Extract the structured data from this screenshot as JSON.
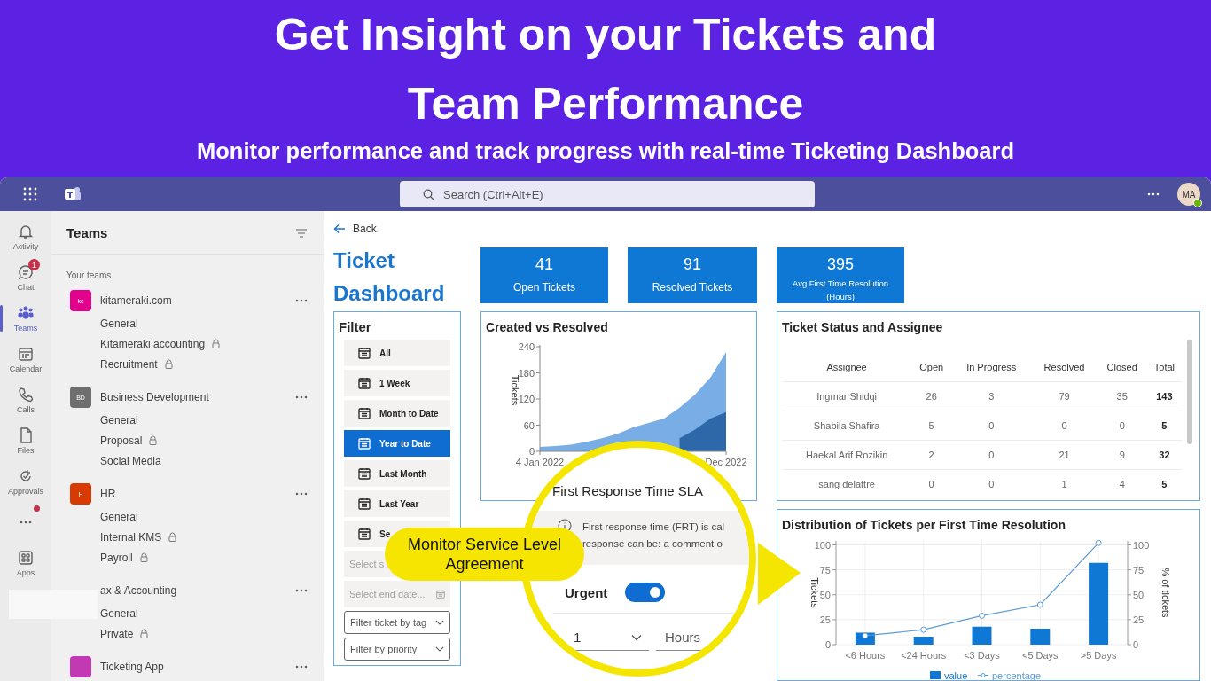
{
  "banner": {
    "headline_lines": [
      "Get Insight on your Tickets and",
      "Team Performance"
    ],
    "subtitle": "Monitor performance and track progress with real-time Ticketing Dashboard"
  },
  "top_bar": {
    "search": {
      "placeholder": "Search (Ctrl+Alt+E)"
    },
    "avatar": "MA"
  },
  "rail": [
    {
      "kind": "app",
      "label": "Activity",
      "selected": false,
      "notification": false
    },
    {
      "kind": "app",
      "label": "Chat",
      "selected": false,
      "badge": "1",
      "notification": false
    },
    {
      "kind": "app",
      "label": "Teams",
      "selected": true,
      "notification": false
    },
    {
      "kind": "app",
      "label": "Calendar",
      "selected": false,
      "notification": false
    },
    {
      "kind": "app",
      "label": "Calls",
      "selected": false,
      "notification": false
    },
    {
      "kind": "app",
      "label": "Files",
      "selected": false,
      "notification": false
    },
    {
      "kind": "app",
      "label": "Approvals",
      "selected": false,
      "notification": false
    },
    {
      "kind": "more",
      "selected": false,
      "notification": true
    },
    {
      "kind": "app",
      "label": "Apps",
      "selected": false,
      "notification": false
    }
  ],
  "teams_panel": {
    "title": "Teams",
    "section": "Your teams",
    "teams": [
      {
        "name": "kitameraki.com",
        "initials": "kc",
        "color": "#e3008c",
        "channels": [
          {
            "name": "General",
            "private": false
          },
          {
            "name": "Kitameraki accounting",
            "private": true
          },
          {
            "name": "Recruitment",
            "private": true
          }
        ]
      },
      {
        "name": "Business Development",
        "initials": "BD",
        "color": "#6e6e6e",
        "channels": [
          {
            "name": "General",
            "private": false
          },
          {
            "name": "Proposal",
            "private": true
          },
          {
            "name": "Social Media",
            "private": false
          }
        ]
      },
      {
        "name": "HR",
        "initials": "H",
        "color": "#d83b01",
        "channels": [
          {
            "name": "General",
            "private": false
          },
          {
            "name": "Internal KMS",
            "private": true
          },
          {
            "name": "Payroll",
            "private": true
          }
        ]
      },
      {
        "name": "ax & Accounting",
        "channels": [
          {
            "name": "General",
            "private": false
          },
          {
            "name": "Private",
            "private": true
          }
        ]
      },
      {
        "name": "Ticketing App",
        "color": "#c239b3"
      }
    ]
  },
  "back": "Back",
  "title": "Ticket Dashboard",
  "kpis": [
    {
      "value": "41",
      "label": "Open Tickets",
      "compact": false
    },
    {
      "value": "91",
      "label": "Resolved Tickets",
      "compact": false
    },
    {
      "value": "395",
      "label": "Avg First Time Resolution (Hours)",
      "compact": true
    }
  ],
  "filter": {
    "title": "Filter",
    "presets": [
      {
        "label": "All",
        "selected": false
      },
      {
        "label": "1 Week",
        "selected": false
      },
      {
        "label": "Month to Date",
        "selected": false
      },
      {
        "label": "Year to Date",
        "selected": true
      },
      {
        "label": "Last Month",
        "selected": false
      },
      {
        "label": "Last Year",
        "selected": false
      },
      {
        "label": "Se",
        "selected": false
      }
    ],
    "date_fields": [
      {
        "placeholder": "Select s"
      },
      {
        "placeholder": "Select end date..."
      }
    ],
    "dropdowns": [
      {
        "placeholder": "Filter ticket by tag"
      },
      {
        "placeholder": "Filter by priority"
      }
    ]
  },
  "created_chart": {
    "title": "Created vs Resolved",
    "chart_data": {
      "type": "area",
      "ylabel": "Tickets",
      "categories": [
        "4 Jan 2022",
        null,
        null,
        null,
        null,
        null,
        null,
        null,
        null,
        null,
        null,
        null,
        "Dec 2022"
      ],
      "ylim": [
        0,
        240
      ],
      "yticks": [
        0,
        60,
        120,
        180,
        240
      ],
      "stacked": false,
      "series": [
        {
          "color": "#78ade6",
          "values": [
            10,
            12,
            15,
            22,
            30,
            40,
            55,
            65,
            75,
            100,
            130,
            170,
            228
          ]
        },
        {
          "color": "#2f68a8",
          "values": [
            null,
            null,
            null,
            null,
            null,
            null,
            null,
            null,
            null,
            30,
            50,
            75,
            90
          ]
        }
      ]
    }
  },
  "status_table": {
    "title": "Ticket Status and Assignee",
    "columns": [
      "Assignee",
      "Open",
      "In Progress",
      "Resolved",
      "Closed",
      "Total"
    ],
    "rows": [
      [
        "Ingmar Shidqi",
        "26",
        "3",
        "79",
        "35",
        "143"
      ],
      [
        "Shabila Shafira",
        "5",
        "0",
        "0",
        "0",
        "5"
      ],
      [
        "Haekal Arif Rozikin",
        "2",
        "0",
        "21",
        "9",
        "32"
      ],
      [
        "sang delattre",
        "0",
        "0",
        "1",
        "4",
        "5"
      ]
    ]
  },
  "distribution": {
    "title": "Distribution of Tickets per First Time Resolution",
    "chart_data": {
      "type": "bar",
      "ylabel": "Tickets",
      "y2label": "% of tickets",
      "categories": [
        "<6 Hours",
        "<24 Hours",
        "<3 Days",
        "<5 Days",
        ">5 Days"
      ],
      "ylim": [
        0,
        104
      ],
      "yticks": [
        0,
        25,
        50,
        75,
        100
      ],
      "y2lim": [
        0,
        104
      ],
      "y2ticks": [
        0,
        25,
        50,
        75,
        100
      ],
      "grid": true,
      "legend": true,
      "series": [
        {
          "name": "value",
          "type": "bar",
          "color": "#0f78d4",
          "values": [
            12,
            8,
            18,
            16,
            82
          ]
        },
        {
          "name": "percentage",
          "type": "line",
          "color": "#5b9bd5",
          "marker": "circle",
          "values": [
            9,
            15,
            29,
            40,
            102
          ]
        }
      ]
    }
  },
  "magnifier": {
    "title": "First Response Time SLA",
    "info_lines": [
      "First response time (FRT) is cal",
      "response can be: a comment o"
    ],
    "toggle": {
      "label": "Urgent",
      "on": true
    },
    "fields": [
      {
        "kind": "dropdown",
        "value": "1"
      },
      {
        "kind": "text",
        "value": "Hours"
      }
    ]
  },
  "callout": "Monitor Service Level Agreement"
}
